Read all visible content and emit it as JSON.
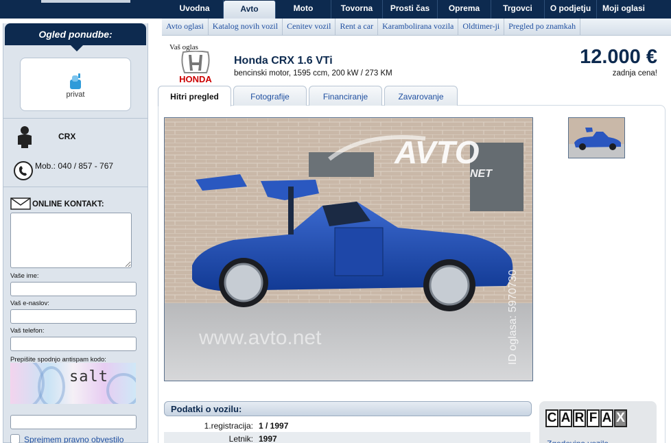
{
  "main_nav": [
    {
      "label": "Uvodna"
    },
    {
      "label": "Avto"
    },
    {
      "label": "Moto"
    },
    {
      "label": "Tovorna"
    },
    {
      "label": "Prosti čas"
    },
    {
      "label": "Oprema"
    },
    {
      "label": "Trgovci"
    },
    {
      "label": "O podjetju"
    },
    {
      "label": "Moji oglasi"
    }
  ],
  "main_nav_active": "Avto",
  "sub_nav": [
    {
      "label": "Avto oglasi"
    },
    {
      "label": "Katalog novih vozil"
    },
    {
      "label": "Cenitev vozil"
    },
    {
      "label": "Rent a car"
    },
    {
      "label": "Karambolirana vozila"
    },
    {
      "label": "Oldtimer-ji"
    },
    {
      "label": "Pregled po znamkah"
    }
  ],
  "sidebar": {
    "title": "Ogled ponudbe:",
    "seller_type": "privat",
    "seller_name": "CRX",
    "phone": "Mob.: 040 / 857 - 767",
    "contact_title": "ONLINE KONTAKT:",
    "message_placeholder": "",
    "name_label": "Vaše ime:",
    "email_label": "Vaš e-naslov:",
    "phone_label": "Vaš telefon:",
    "captcha_label": "Prepišite spodnjo antispam kodo:",
    "captcha_code": "salt",
    "accept_label": "Sprejmem pravno obvestilo"
  },
  "listing": {
    "ad_label": "Vaš oglas",
    "brand": "HONDA",
    "title": "Honda CRX 1.6 VTi",
    "subtitle": "bencinski motor,  1595 ccm, 200 kW / 273 KM",
    "price": "12.000 €",
    "price_note": "zadnja cena!"
  },
  "tabs": [
    {
      "label": "Hitri pregled",
      "active": true
    },
    {
      "label": "Fotografije",
      "active": false
    },
    {
      "label": "Financiranje",
      "active": false
    },
    {
      "label": "Zavarovanje",
      "active": false
    }
  ],
  "photo": {
    "watermark_brand": "AVTO",
    "watermark_suffix": "NET",
    "watermark_url": "www.avto.net",
    "ad_id": "ID oglasa: 5970730"
  },
  "details": {
    "heading": "Podatki o vozilu:",
    "rows": [
      {
        "key": "1.registracija:",
        "value": "1 / 1997"
      },
      {
        "key": "Letnik:",
        "value": "1997"
      }
    ]
  },
  "carfax": {
    "letters": [
      "C",
      "A",
      "R",
      "F",
      "A",
      "X"
    ],
    "subtext": "Zgodovina vozila"
  },
  "colors": {
    "navy": "#0d2a4f",
    "link": "#1f4fa0",
    "car_blue": "#1f4fb0",
    "honda_red": "#cc0000"
  },
  "icons": {
    "privat": "privat-icon",
    "person": "person-icon",
    "phone": "phone-icon",
    "mail": "mail-icon"
  }
}
